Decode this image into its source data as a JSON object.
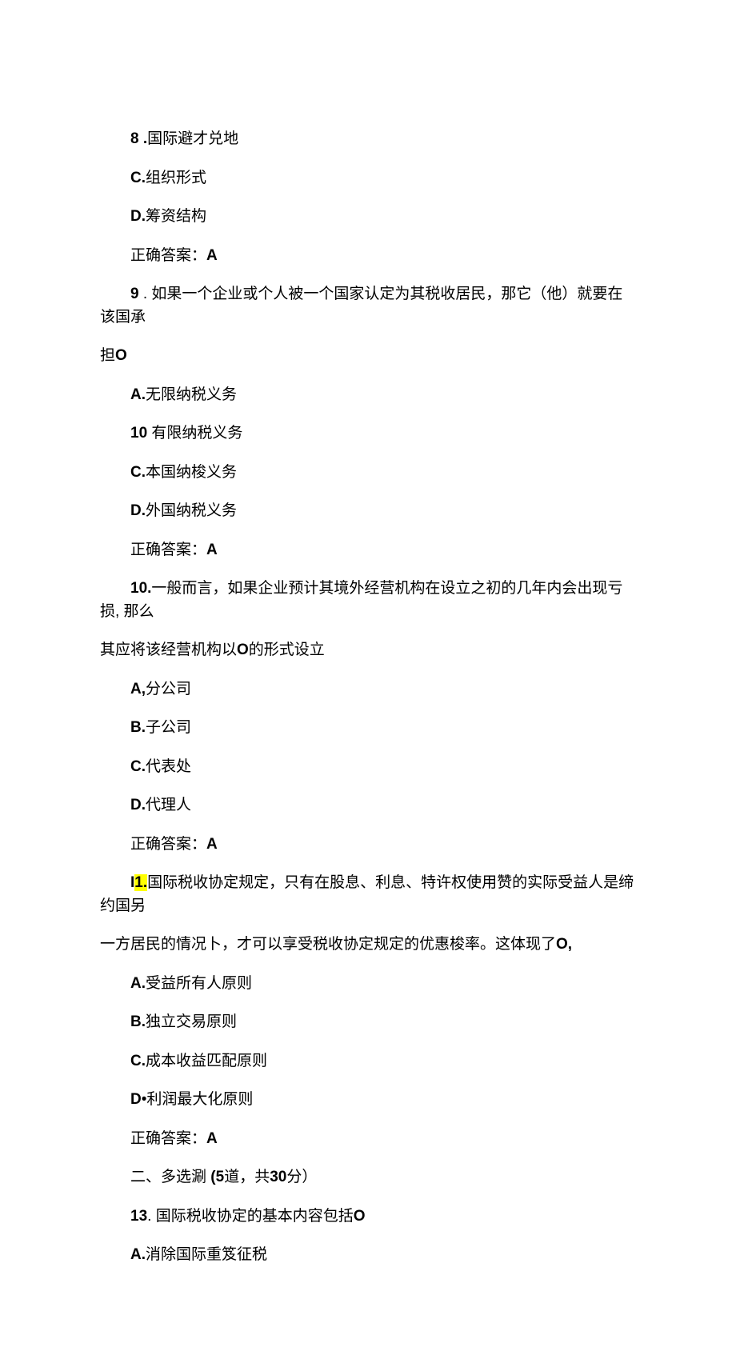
{
  "lines": [
    {
      "segments": [
        {
          "text": "8 .",
          "bold": true
        },
        {
          "text": "国际避才兑地"
        }
      ],
      "indent": true
    },
    {
      "segments": [
        {
          "text": "C.",
          "bold": true
        },
        {
          "text": "组织形式"
        }
      ],
      "indent": true
    },
    {
      "segments": [
        {
          "text": "D.",
          "bold": true
        },
        {
          "text": "筹资结构"
        }
      ],
      "indent": true
    },
    {
      "segments": [
        {
          "text": "正确答案："
        },
        {
          "text": "A",
          "bold": true
        }
      ],
      "indent": true
    },
    {
      "segments": [
        {
          "text": "9",
          "bold": true
        },
        {
          "text": " . 如果一个企业或个人被一个国家认定为其税收居民，那它（他）就要在该国承"
        }
      ],
      "indent": true
    },
    {
      "segments": [
        {
          "text": "担"
        },
        {
          "text": "O",
          "bold": true
        }
      ],
      "indent": false
    },
    {
      "segments": [
        {
          "text": "A.",
          "bold": true
        },
        {
          "text": "无限纳税义务"
        }
      ],
      "indent": true
    },
    {
      "segments": [
        {
          "text": "10",
          "bold": true
        },
        {
          "text": " 有限纳税义务"
        }
      ],
      "indent": true
    },
    {
      "segments": [
        {
          "text": "C.",
          "bold": true
        },
        {
          "text": "本国纳梭义务"
        }
      ],
      "indent": true
    },
    {
      "segments": [
        {
          "text": "D.",
          "bold": true
        },
        {
          "text": "外国纳税义务"
        }
      ],
      "indent": true
    },
    {
      "segments": [
        {
          "text": "正确答案："
        },
        {
          "text": "A",
          "bold": true
        }
      ],
      "indent": true
    },
    {
      "segments": [
        {
          "text": "10.",
          "bold": true
        },
        {
          "text": "一般而言，如果企业预计其境外经营机构在设立之初的几年内会出现亏损, 那么"
        }
      ],
      "indent": true
    },
    {
      "segments": [
        {
          "text": "其应将该经营机构以"
        },
        {
          "text": "O",
          "bold": true
        },
        {
          "text": "的形式设立"
        }
      ],
      "indent": false
    },
    {
      "segments": [
        {
          "text": "A,",
          "bold": true
        },
        {
          "text": "分公司"
        }
      ],
      "indent": true
    },
    {
      "segments": [
        {
          "text": "B.",
          "bold": true
        },
        {
          "text": "子公司"
        }
      ],
      "indent": true
    },
    {
      "segments": [
        {
          "text": "C.",
          "bold": true
        },
        {
          "text": "代表处"
        }
      ],
      "indent": true
    },
    {
      "segments": [
        {
          "text": "D.",
          "bold": true
        },
        {
          "text": "代理人"
        }
      ],
      "indent": true
    },
    {
      "segments": [
        {
          "text": "正确答案："
        },
        {
          "text": "A",
          "bold": true
        }
      ],
      "indent": true
    },
    {
      "segments": [
        {
          "text": "I",
          "bold": true
        },
        {
          "text": "1.",
          "bold": true,
          "highlight": true
        },
        {
          "text": "国际税收协定规定，只有在股息、利息、特许权使用赞的实际受益人是缔约国另"
        }
      ],
      "indent": true
    },
    {
      "segments": [
        {
          "text": "一方居民的情况卜，才可以享受税收协定规定的优惠梭率。这体现了"
        },
        {
          "text": "O,",
          "bold": true
        }
      ],
      "indent": false
    },
    {
      "segments": [
        {
          "text": "A.",
          "bold": true
        },
        {
          "text": "受益所有人原则"
        }
      ],
      "indent": true
    },
    {
      "segments": [
        {
          "text": "B.",
          "bold": true
        },
        {
          "text": "独立交易原则"
        }
      ],
      "indent": true
    },
    {
      "segments": [
        {
          "text": "C.",
          "bold": true
        },
        {
          "text": "成本收益匹配原则"
        }
      ],
      "indent": true
    },
    {
      "segments": [
        {
          "text": "D",
          "bold": true
        },
        {
          "text": "•利润最大化原则"
        }
      ],
      "indent": true
    },
    {
      "segments": [
        {
          "text": "正确答案："
        },
        {
          "text": "A",
          "bold": true
        }
      ],
      "indent": true
    },
    {
      "segments": [
        {
          "text": "二、多选涮 "
        },
        {
          "text": "(5",
          "bold": true
        },
        {
          "text": "道，共"
        },
        {
          "text": "30",
          "bold": true
        },
        {
          "text": "分）"
        }
      ],
      "indent": true
    },
    {
      "segments": [
        {
          "text": "13",
          "bold": true
        },
        {
          "text": ". 国际税收协定的基本内容包括"
        },
        {
          "text": "O",
          "bold": true
        }
      ],
      "indent": true
    },
    {
      "segments": [
        {
          "text": "A.",
          "bold": true
        },
        {
          "text": "消除国际重笈征税"
        }
      ],
      "indent": true
    }
  ]
}
